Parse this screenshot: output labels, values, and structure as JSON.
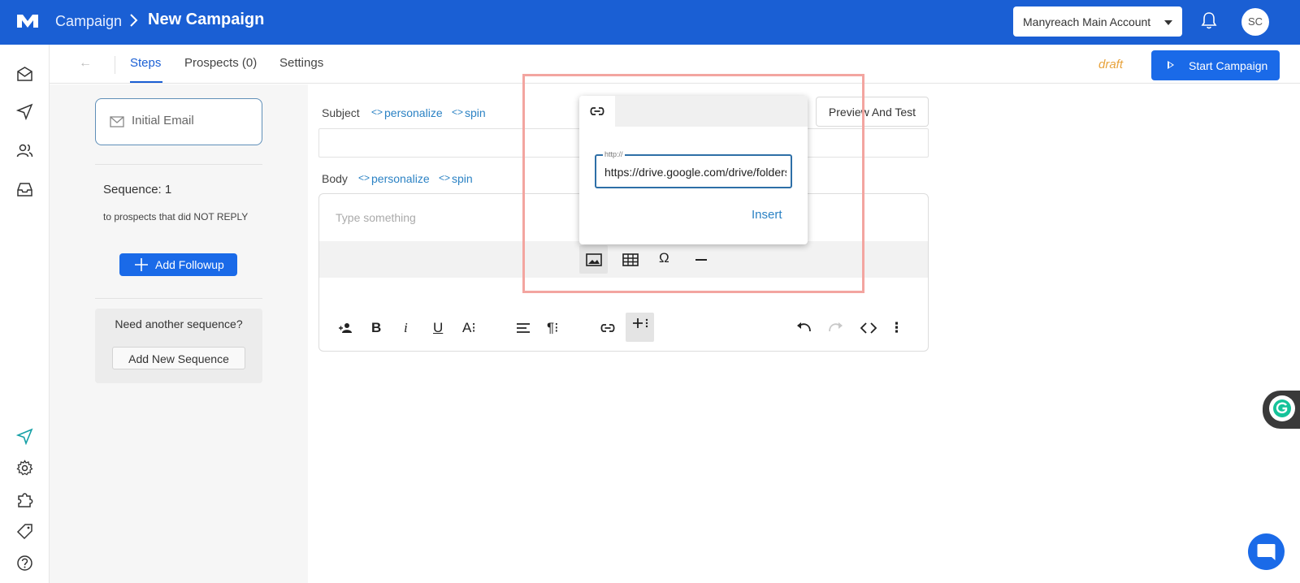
{
  "header": {
    "breadcrumb_root": "Campaign",
    "breadcrumb_current": "New Campaign",
    "account_selector": "Manyreach Main Account",
    "avatar_initials": "SC",
    "brand_color": "#1a5fd4"
  },
  "sidebar": {
    "icons": [
      "mail-icon",
      "send-icon",
      "users-icon",
      "inbox-icon",
      "send-active-icon",
      "gear-icon",
      "puzzle-icon",
      "tag-icon",
      "help-icon"
    ]
  },
  "tabs": {
    "back": "←",
    "items": [
      {
        "label": "Steps",
        "active": true
      },
      {
        "label": "Prospects (0)",
        "active": false
      },
      {
        "label": "Settings",
        "active": false
      }
    ],
    "status": "draft",
    "start_button": "Start Campaign"
  },
  "sequence": {
    "initial_email": "Initial Email",
    "title": "Sequence: 1",
    "condition": "to prospects that did NOT REPLY",
    "add_followup": "Add Followup",
    "need_another": "Need another sequence?",
    "add_new_sequence": "Add New Sequence"
  },
  "editor": {
    "subject_label": "Subject",
    "body_label": "Body",
    "personalize": "personalize",
    "spin": "spin",
    "code_glyph": "<>",
    "preview_button": "Preview And Test",
    "body_placeholder": "Type something",
    "toolbar": {
      "bold": "B",
      "italic": "i",
      "underline": "U",
      "font_size": "A⁝",
      "paragraph": "¶⁝",
      "special_chars": "Ω",
      "more": "⋮"
    }
  },
  "link_popup": {
    "url_label": "http://",
    "url_value": "https://drive.google.com/drive/folders",
    "insert_button": "Insert"
  }
}
